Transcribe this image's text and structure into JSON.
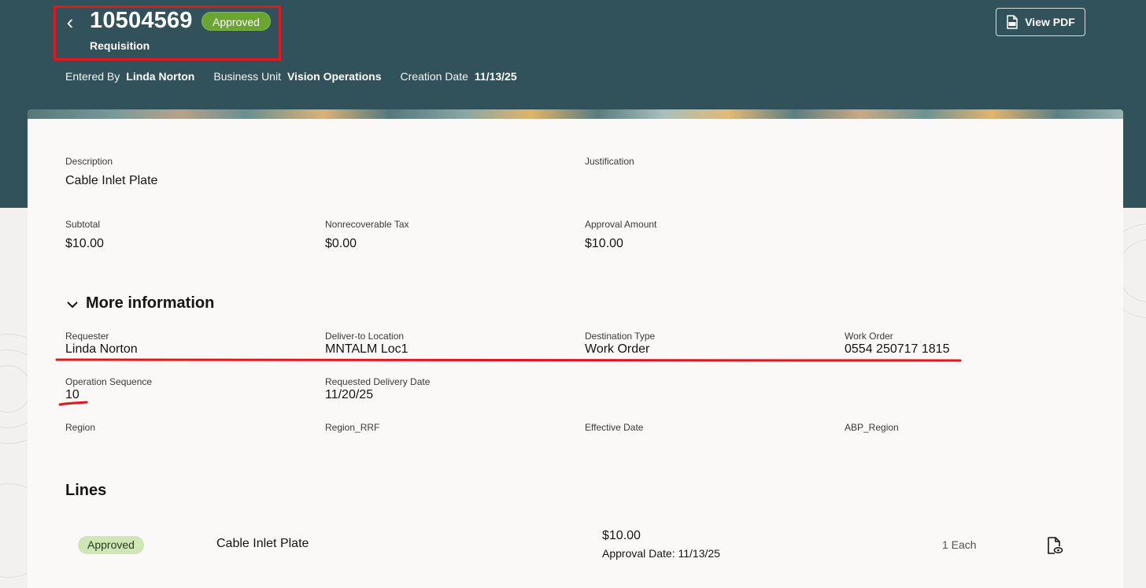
{
  "header": {
    "back_glyph": "‹",
    "requisition_number": "10504569",
    "status": "Approved",
    "document_type": "Requisition",
    "meta": [
      {
        "label": "Entered By",
        "value": "Linda Norton"
      },
      {
        "label": "Business Unit",
        "value": "Vision Operations"
      },
      {
        "label": "Creation Date",
        "value": "11/13/25"
      }
    ],
    "view_pdf_label": "View PDF",
    "view_pdf_icon": "pdf-file-icon"
  },
  "summary": {
    "description_label": "Description",
    "description_value": "Cable Inlet Plate",
    "justification_label": "Justification",
    "subtotal_label": "Subtotal",
    "subtotal_value": "$10.00",
    "tax_label": "Nonrecoverable Tax",
    "tax_value": "$0.00",
    "approval_amount_label": "Approval Amount",
    "approval_amount_value": "$10.00"
  },
  "more_info": {
    "title": "More information",
    "expanded_icon": "chevron-down-icon",
    "requester_label": "Requester",
    "requester_value": "Linda Norton",
    "deliver_to_label": "Deliver-to Location",
    "deliver_to_value": "MNTALM Loc1",
    "destination_type_label": "Destination Type",
    "destination_type_value": "Work Order",
    "work_order_label": "Work Order",
    "work_order_value": "0554 250717 1815",
    "operation_sequence_label": "Operation Sequence",
    "operation_sequence_value": "10",
    "requested_delivery_label": "Requested Delivery Date",
    "requested_delivery_value": "11/20/25",
    "region_label": "Region",
    "region_rrf_label": "Region_RRF",
    "effective_date_label": "Effective Date",
    "abp_region_label": "ABP_Region"
  },
  "lines": {
    "title": "Lines",
    "items": [
      {
        "status": "Approved",
        "description": "Cable Inlet Plate",
        "amount": "$10.00",
        "approval_date": "Approval Date: 11/13/25",
        "quantity": "1 Each",
        "action_icon": "document-view-icon"
      }
    ]
  },
  "colors": {
    "header_bg": "#31525a",
    "status_green": "#6aa532",
    "line_status_bg": "#cfe6b6",
    "annotation_red": "#e0171d"
  }
}
